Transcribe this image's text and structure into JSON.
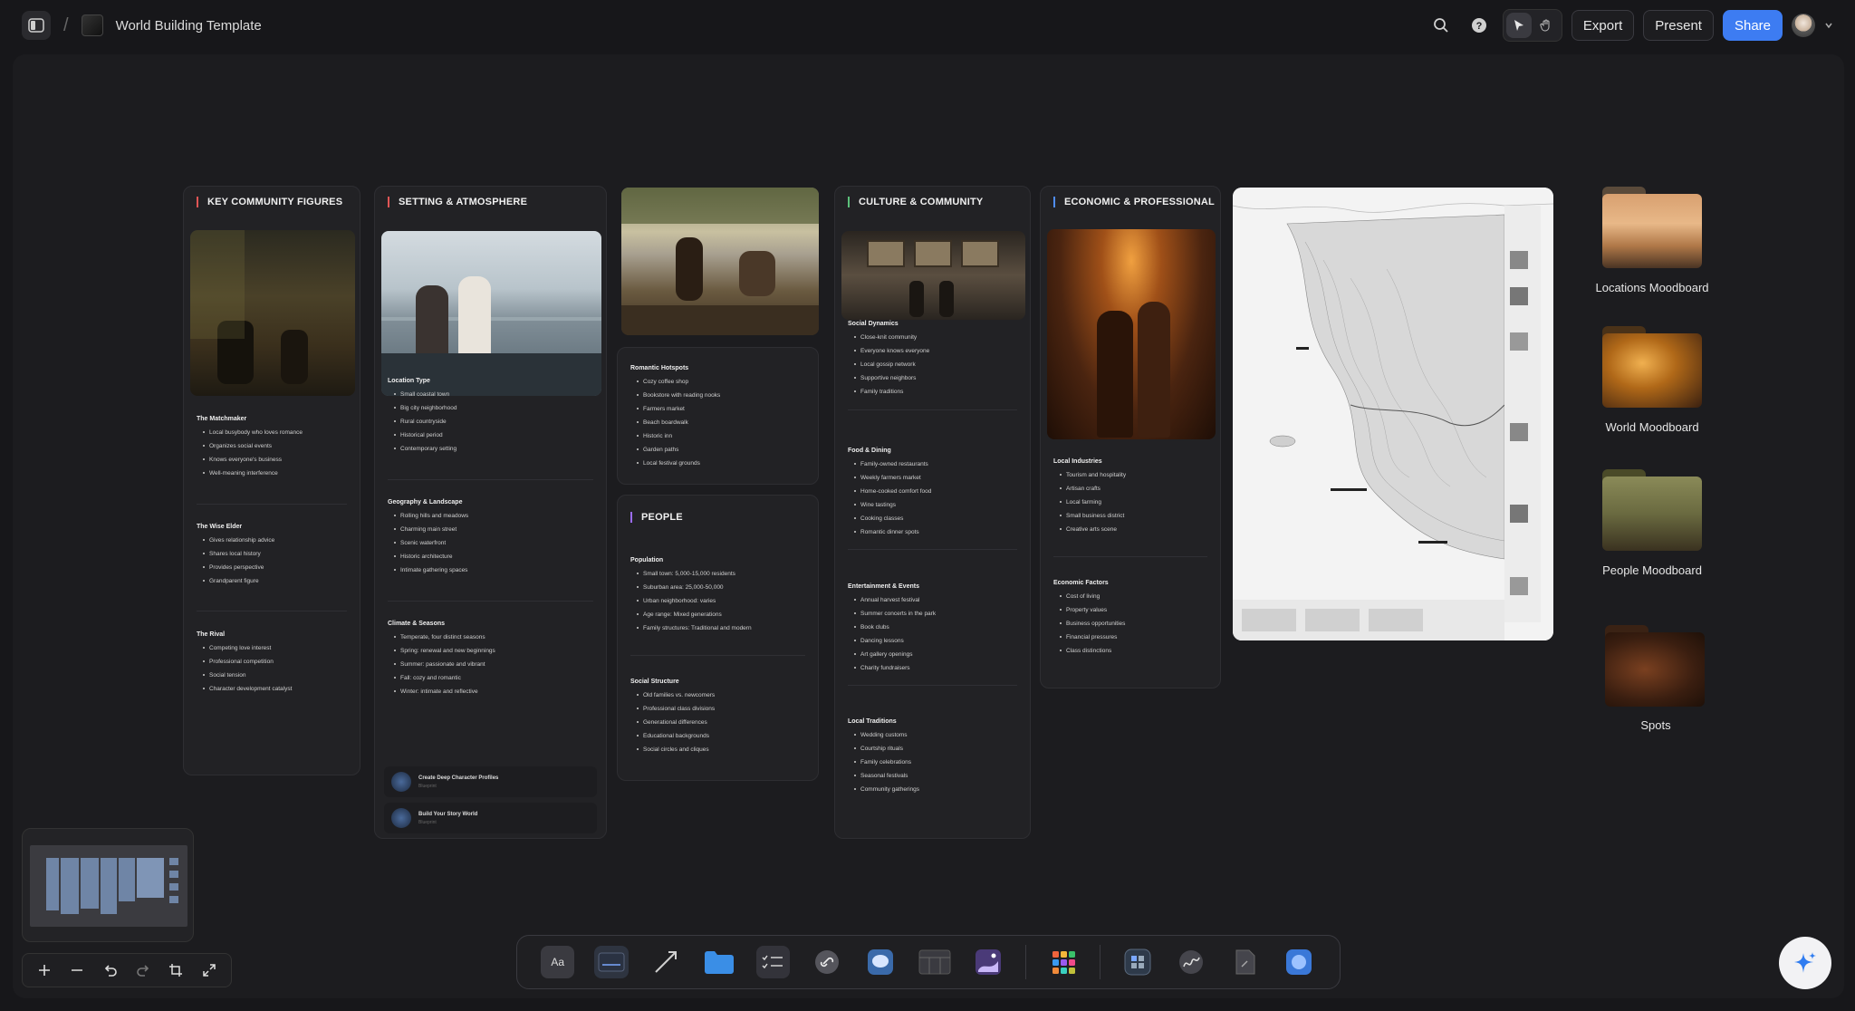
{
  "app": {
    "title": "World Building Template"
  },
  "toolbar": {
    "export_label": "Export",
    "present_label": "Present",
    "share_label": "Share"
  },
  "cards": {
    "key_figures": {
      "title": "KEY COMMUNITY FIGURES",
      "sections": [
        {
          "head": "The Matchmaker",
          "items": [
            "Local busybody who loves romance",
            "Organizes social events",
            "Knows everyone's business",
            "Well-meaning interference"
          ]
        },
        {
          "head": "The Wise Elder",
          "items": [
            "Gives relationship advice",
            "Shares local history",
            "Provides perspective",
            "Grandparent figure"
          ]
        },
        {
          "head": "The Rival",
          "items": [
            "Competing love interest",
            "Professional competition",
            "Social tension",
            "Character development catalyst"
          ]
        }
      ]
    },
    "setting": {
      "title": "SETTING & ATMOSPHERE",
      "sections": [
        {
          "head": "Location Type",
          "items": [
            "Small coastal town",
            "Big city neighborhood",
            "Rural countryside",
            "Historical period",
            "Contemporary setting"
          ]
        },
        {
          "head": "Geography & Landscape",
          "items": [
            "Rolling hills and meadows",
            "Charming main street",
            "Scenic waterfront",
            "Historic architecture",
            "Intimate gathering spaces"
          ]
        },
        {
          "head": "Climate & Seasons",
          "items": [
            "Temperate, four distinct seasons",
            "Spring: renewal and new beginnings",
            "Summer: passionate and vibrant",
            "Fall: cozy and romantic",
            "Winter: intimate and reflective"
          ]
        }
      ],
      "links": [
        {
          "title": "Create Deep Character Profiles",
          "sub": "Blueprint"
        },
        {
          "title": "Build Your Story World",
          "sub": "Blueprint"
        }
      ]
    },
    "hotspots": {
      "head": "Romantic Hotspots",
      "items": [
        "Cozy coffee shop",
        "Bookstore with reading nooks",
        "Farmers market",
        "Beach boardwalk",
        "Historic inn",
        "Garden paths",
        "Local festival grounds"
      ]
    },
    "people": {
      "title": "PEOPLE",
      "sections": [
        {
          "head": "Population",
          "items": [
            "Small town: 5,000-15,000 residents",
            "Suburban area: 25,000-50,000",
            "Urban neighborhood: varies",
            "Age range: Mixed generations",
            "Family structures: Traditional and modern"
          ]
        },
        {
          "head": "Social Structure",
          "items": [
            "Old families vs. newcomers",
            "Professional class divisions",
            "Generational differences",
            "Educational backgrounds",
            "Social circles and cliques"
          ]
        }
      ]
    },
    "culture": {
      "title": "CULTURE & COMMUNITY",
      "sections": [
        {
          "head": "Social Dynamics",
          "items": [
            "Close-knit community",
            "Everyone knows everyone",
            "Local gossip network",
            "Supportive neighbors",
            "Family traditions"
          ]
        },
        {
          "head": "Food & Dining",
          "items": [
            "Family-owned restaurants",
            "Weekly farmers market",
            "Home-cooked comfort food",
            "Wine tastings",
            "Cooking classes",
            "Romantic dinner spots"
          ]
        },
        {
          "head": "Entertainment & Events",
          "items": [
            "Annual harvest festival",
            "Summer concerts in the park",
            "Book clubs",
            "Dancing lessons",
            "Art gallery openings",
            "Charity fundraisers"
          ]
        },
        {
          "head": "Local Traditions",
          "items": [
            "Wedding customs",
            "Courtship rituals",
            "Family celebrations",
            "Seasonal festivals",
            "Community gatherings"
          ]
        }
      ]
    },
    "economic": {
      "title": "ECONOMIC & PROFESSIONAL",
      "sections": [
        {
          "head": "Local Industries",
          "items": [
            "Tourism and hospitality",
            "Artisan crafts",
            "Local farming",
            "Small business district",
            "Creative arts scene"
          ]
        },
        {
          "head": "Economic Factors",
          "items": [
            "Cost of living",
            "Property values",
            "Business opportunities",
            "Financial pressures",
            "Class distinctions"
          ]
        }
      ]
    }
  },
  "folders": [
    {
      "label": "Locations Moodboard"
    },
    {
      "label": "World Moodboard"
    },
    {
      "label": "People Moodboard"
    },
    {
      "label": "Spots"
    }
  ],
  "dock": {
    "text_tool_label": "Aa"
  }
}
